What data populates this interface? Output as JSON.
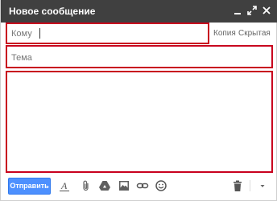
{
  "window": {
    "title": "Новое сообщение",
    "controls": [
      "minimize-icon",
      "expand-icon",
      "close-icon"
    ]
  },
  "to": {
    "label": "Кому",
    "value": ""
  },
  "cc_links": {
    "copy_label": "Копия",
    "bcc_label": "Скрытая"
  },
  "subject": {
    "placeholder": "Тема",
    "value": ""
  },
  "body": {
    "value": ""
  },
  "toolbar": {
    "send_label": "Отправить",
    "tools": [
      "text-format-icon",
      "attach-file-icon",
      "google-drive-icon",
      "insert-photo-icon",
      "insert-link-icon",
      "insert-emoji-icon",
      "trash-icon",
      "more-options-chevron-icon"
    ]
  },
  "colors": {
    "titlebar": "#404040",
    "accent_blue": "#4d90fe",
    "highlight_red": "#c8001e"
  }
}
